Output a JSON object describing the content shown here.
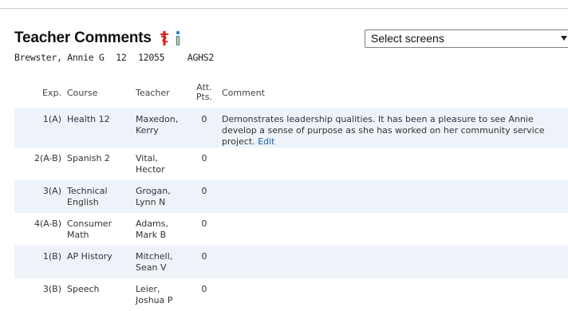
{
  "page": {
    "title": "Teacher Comments"
  },
  "student": {
    "name": "Brewster, Annie G",
    "grade": "12",
    "id": "12055",
    "school": "AGHS2"
  },
  "screen_select": {
    "value": "Select screens"
  },
  "table": {
    "headers": {
      "exp": "Exp.",
      "course": "Course",
      "teacher": "Teacher",
      "att": "Att. Pts.",
      "comment": "Comment"
    },
    "rows": [
      {
        "exp": "1(A)",
        "course": "Health 12",
        "teacher": "Maxedon, Kerry",
        "att": "0",
        "comment": "Demonstrates leadership qualities. It has been a pleasure to see Annie develop a sense of purpose as she has worked on her community service project.",
        "edit": "Edit"
      },
      {
        "exp": "2(A-B)",
        "course": "Spanish 2",
        "teacher": "Vital, Hector",
        "att": "0",
        "comment": ""
      },
      {
        "exp": "3(A)",
        "course": "Technical English",
        "teacher": "Grogan, Lynn N",
        "att": "0",
        "comment": ""
      },
      {
        "exp": "4(A-B)",
        "course": "Consumer Math",
        "teacher": "Adams, Mark B",
        "att": "0",
        "comment": ""
      },
      {
        "exp": "1(B)",
        "course": "AP History",
        "teacher": "Mitchell, Sean V",
        "att": "0",
        "comment": ""
      },
      {
        "exp": "3(B)",
        "course": "Speech",
        "teacher": "Leier, Joshua P",
        "att": "0",
        "comment": ""
      }
    ]
  },
  "icons": {
    "alert": "medical-alert-icon",
    "info": "info-icon"
  },
  "colors": {
    "row_shade": "#eef3fa",
    "link": "#1a5fb0",
    "alert": "#d62020",
    "info": "#2f7fd9"
  }
}
